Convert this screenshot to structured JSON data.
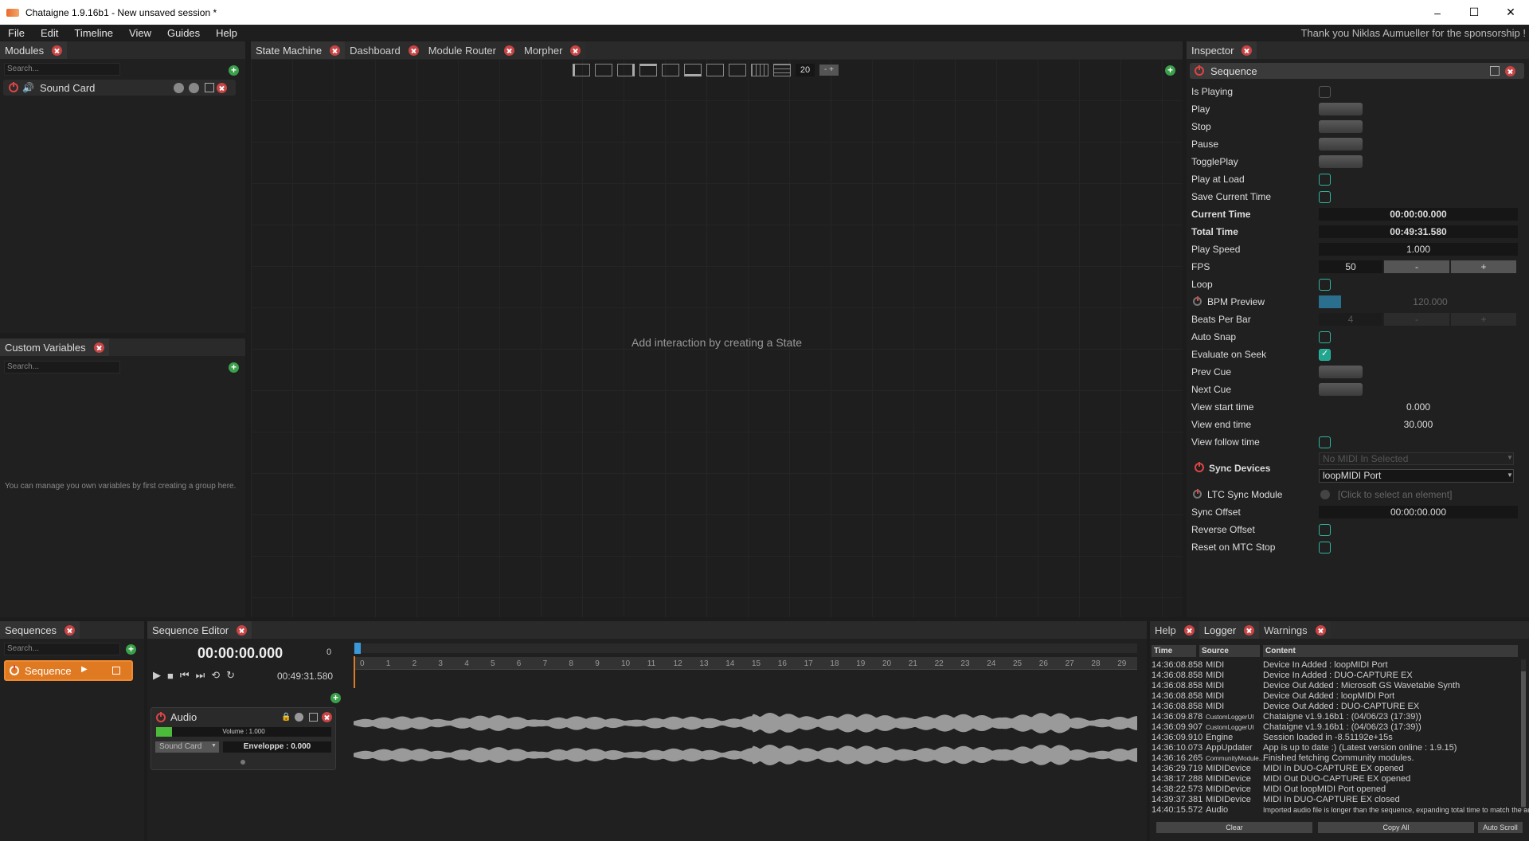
{
  "window": {
    "title": "Chataigne 1.9.16b1 - New unsaved session *",
    "min": "–",
    "max": "☐",
    "close": "✕"
  },
  "menu": {
    "items": [
      "File",
      "Edit",
      "Timeline",
      "View",
      "Guides",
      "Help"
    ],
    "sponsor": "Thank you Niklas Aumueller for the sponsorship !"
  },
  "modules": {
    "tab": "Modules",
    "search_placeholder": "Search...",
    "items": [
      {
        "name": "Sound Card"
      }
    ]
  },
  "custom_vars": {
    "tab": "Custom Variables",
    "search_placeholder": "Search...",
    "empty_message": "You can manage you own variables by first creating a group here."
  },
  "center_tabs": [
    {
      "label": "State Machine",
      "active": true
    },
    {
      "label": "Dashboard"
    },
    {
      "label": "Module Router"
    },
    {
      "label": "Morpher"
    }
  ],
  "state_machine": {
    "grid_value": "20",
    "empty_message": "Add interaction by creating a State"
  },
  "inspector": {
    "tab": "Inspector",
    "header": "Sequence",
    "is_playing": "Is Playing",
    "play": "Play",
    "stop": "Stop",
    "pause": "Pause",
    "toggle_play": "TogglePlay",
    "play_at_load": "Play at Load",
    "save_current_time": "Save Current Time",
    "current_time_label": "Current Time",
    "current_time": "00:00:00.000",
    "total_time_label": "Total Time",
    "total_time": "00:49:31.580",
    "play_speed_label": "Play Speed",
    "play_speed": "1.000",
    "fps_label": "FPS",
    "fps": "50",
    "fps_minus": "-",
    "fps_plus": "+",
    "loop": "Loop",
    "bpm_label": "BPM Preview",
    "bpm": "120.000",
    "beats_label": "Beats Per Bar",
    "beats": "4",
    "beats_minus": "-",
    "beats_plus": "+",
    "auto_snap": "Auto Snap",
    "evaluate_on_seek": "Evaluate on Seek",
    "prev_cue": "Prev Cue",
    "next_cue": "Next Cue",
    "view_start_label": "View start time",
    "view_start": "0.000",
    "view_end_label": "View end time",
    "view_end": "30.000",
    "view_follow": "View follow time",
    "sync_devices": "Sync Devices",
    "midi_in": "No MIDI In Selected",
    "midi_out": "loopMIDI Port",
    "ltc_label": "LTC Sync Module",
    "ltc_value": "[Click to select an element]",
    "sync_offset_label": "Sync Offset",
    "sync_offset": "00:00:00.000",
    "reverse_offset": "Reverse Offset",
    "reset_mtc": "Reset on MTC Stop"
  },
  "sequences": {
    "tab": "Sequences",
    "search_placeholder": "Search...",
    "items": [
      {
        "name": "Sequence"
      }
    ]
  },
  "seq_editor": {
    "tab": "Sequence Editor",
    "time": "00:00:00.000",
    "frame": "0",
    "total": "00:49:31.580",
    "ticks": [
      "0",
      "1",
      "2",
      "3",
      "4",
      "5",
      "6",
      "7",
      "8",
      "9",
      "10",
      "11",
      "12",
      "13",
      "14",
      "15",
      "16",
      "17",
      "18",
      "19",
      "20",
      "21",
      "22",
      "23",
      "24",
      "25",
      "26",
      "27",
      "28",
      "29"
    ],
    "layer": {
      "name": "Audio",
      "volume": "Volume : 1.000",
      "device": "Sound Card",
      "envelope": "Enveloppe : 0.000"
    }
  },
  "logger": {
    "tabs": [
      "Help",
      "Logger",
      "Warnings"
    ],
    "columns": [
      "Time",
      "Source",
      "Content"
    ],
    "rows": [
      {
        "time": "14:36:08.858",
        "source": "MIDI",
        "content": "Device In Added : loopMIDI Port"
      },
      {
        "time": "14:36:08.858",
        "source": "MIDI",
        "content": "Device In Added : DUO-CAPTURE EX"
      },
      {
        "time": "14:36:08.858",
        "source": "MIDI",
        "content": "Device Out Added : Microsoft GS Wavetable Synth"
      },
      {
        "time": "14:36:08.858",
        "source": "MIDI",
        "content": "Device Out Added : loopMIDI Port"
      },
      {
        "time": "14:36:08.858",
        "source": "MIDI",
        "content": "Device Out Added : DUO-CAPTURE EX"
      },
      {
        "time": "14:36:09.878",
        "source": "CustomLoggerUI",
        "content": "Chataigne v1.9.16b1 : (04/06/23 (17:39))"
      },
      {
        "time": "14:36:09.907",
        "source": "CustomLoggerUI",
        "content": "Chataigne v1.9.16b1 : (04/06/23 (17:39))"
      },
      {
        "time": "14:36:09.910",
        "source": "Engine",
        "content": "Session loaded in -8.51192e+15s"
      },
      {
        "time": "14:36:10.073",
        "source": "AppUpdater",
        "content": "App is up to date :) (Latest version online : 1.9.15)"
      },
      {
        "time": "14:36:16.265",
        "source": "CommunityModule...",
        "content": "Finished fetching Community modules."
      },
      {
        "time": "14:36:29.719",
        "source": "MIDIDevice",
        "content": "MIDI In DUO-CAPTURE EX opened"
      },
      {
        "time": "14:38:17.288",
        "source": "MIDIDevice",
        "content": "MIDI Out DUO-CAPTURE EX opened"
      },
      {
        "time": "14:38:22.573",
        "source": "MIDIDevice",
        "content": "MIDI Out loopMIDI Port opened"
      },
      {
        "time": "14:39:37.381",
        "source": "MIDIDevice",
        "content": "MIDI In DUO-CAPTURE EX closed"
      },
      {
        "time": "14:40:15.572",
        "source": "Audio",
        "content": "Imported audio file is longer than the sequence, expanding total time to match the audio ..."
      }
    ],
    "clear": "Clear",
    "copy_all": "Copy All",
    "auto_scroll": "Auto Scroll"
  }
}
